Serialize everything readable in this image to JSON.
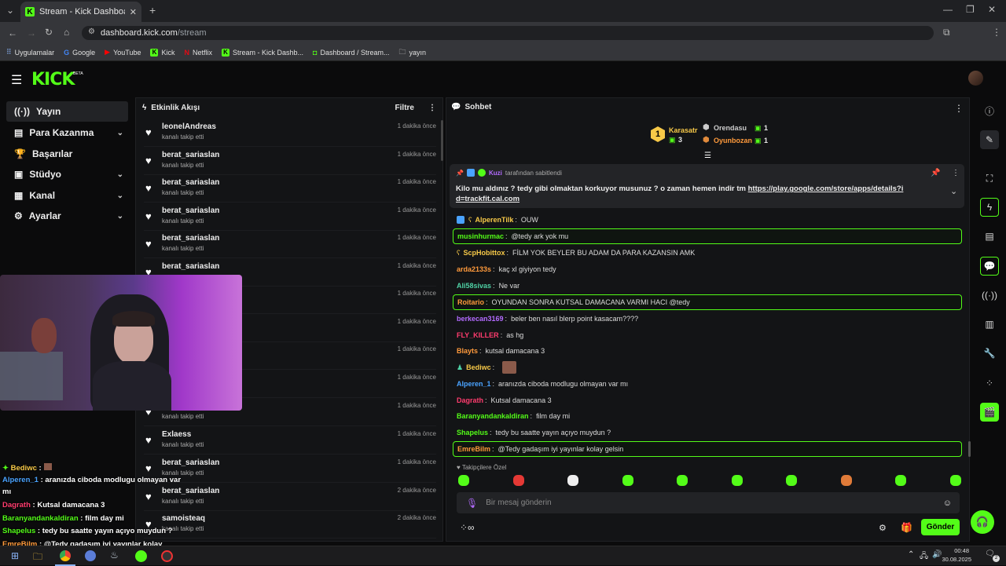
{
  "browser": {
    "tab_title": "Stream - Kick Dashboard",
    "url_domain": "dashboard.kick.com",
    "url_path": "/stream",
    "bookmarks": [
      "Uygulamalar",
      "Google",
      "YouTube",
      "Kick",
      "Netflix",
      "Stream - Kick Dashb...",
      "Dashboard / Stream...",
      "yayın"
    ]
  },
  "kick": {
    "logo": "KICK",
    "beta": "BETA"
  },
  "sidebar": {
    "items": [
      {
        "label": "Yayın",
        "icon": "broadcast-icon",
        "active": true
      },
      {
        "label": "Para Kazanma",
        "icon": "money-icon",
        "chevron": true
      },
      {
        "label": "Başarılar",
        "icon": "trophy-icon"
      },
      {
        "label": "Stüdyo",
        "icon": "studio-icon",
        "chevron": true
      },
      {
        "label": "Kanal",
        "icon": "channel-icon",
        "chevron": true
      },
      {
        "label": "Ayarlar",
        "icon": "gear-icon",
        "chevron": true
      }
    ]
  },
  "activity": {
    "title": "Etkinlik Akışı",
    "filter": "Filtre",
    "items": [
      {
        "name": "leonelAndreas",
        "action": "kanalı takip etti",
        "time": "1 dakika önce"
      },
      {
        "name": "berat_sariaslan",
        "action": "kanalı takip etti",
        "time": "1 dakika önce"
      },
      {
        "name": "berat_sariaslan",
        "action": "kanalı takip etti",
        "time": "1 dakika önce"
      },
      {
        "name": "berat_sariaslan",
        "action": "kanalı takip etti",
        "time": "1 dakika önce"
      },
      {
        "name": "berat_sariaslan",
        "action": "kanalı takip etti",
        "time": "1 dakika önce"
      },
      {
        "name": "berat_sariaslan",
        "action": "",
        "time": "1 dakika önce"
      },
      {
        "name": "",
        "action": "",
        "time": "1 dakika önce"
      },
      {
        "name": "",
        "action": "",
        "time": "1 dakika önce"
      },
      {
        "name": "",
        "action": "",
        "time": "1 dakika önce"
      },
      {
        "name": "",
        "action": "",
        "time": "1 dakika önce"
      },
      {
        "name": "berat_sariaslan",
        "action": "kanalı takip etti",
        "time": "1 dakika önce"
      },
      {
        "name": "Exlaess",
        "action": "kanalı takip etti",
        "time": "1 dakika önce"
      },
      {
        "name": "berat_sariaslan",
        "action": "kanalı takip etti",
        "time": "1 dakika önce"
      },
      {
        "name": "berat_sariaslan",
        "action": "kanalı takip etti",
        "time": "2 dakika önce"
      },
      {
        "name": "samoisteaq",
        "action": "kanalı takip etti",
        "time": "2 dakika önce"
      }
    ]
  },
  "chat": {
    "title": "Sohbet",
    "leaders": {
      "first_name": "Karasatr",
      "first_count": "3",
      "first_rank": "1",
      "second_name": "Orendasu",
      "second_count": "1",
      "third_name": "Oyunbozan",
      "third_count": "1"
    },
    "pinned": {
      "by": "Kuzi",
      "by_suffix": "tarafından sabitlendi",
      "text": "Kilo mu aldınız ? tedy gibi olmaktan korkuyor musunuz ? o zaman hemen indir tm",
      "link": "https://play.google.com/store/apps/details?id=trackfit.cal.com"
    },
    "messages": [
      {
        "user": "AlperenTilk",
        "text": "OUW",
        "color": "#f7c948",
        "hl": false
      },
      {
        "user": "musinhurmac",
        "text": "@tedy ark yok mu",
        "color": "#53fc18",
        "hl": true
      },
      {
        "user": "ScpHobittox",
        "text": "FİLM YOK BEYLER BU ADAM DA PARA KAZANSIN AMK",
        "color": "#f7c948",
        "hl": false
      },
      {
        "user": "arda2133s",
        "text": "kaç xl giyiyon tedy",
        "color": "#ff9a3c",
        "hl": false
      },
      {
        "user": "Ali58sivas",
        "text": "Ne var",
        "color": "#4fd1a5",
        "hl": false
      },
      {
        "user": "Roitario",
        "text": "OYUNDAN SONRA KUTSAL DAMACANA VARMI HACI @tedy",
        "color": "#ff9a3c",
        "hl": true
      },
      {
        "user": "berkecan3169",
        "text": "beler ben nasıl blerp point kasacam????",
        "color": "#b36bff",
        "hl": false
      },
      {
        "user": "FLY_KILLER",
        "text": "as hg",
        "color": "#ff3c6e",
        "hl": false
      },
      {
        "user": "Blayts",
        "text": "kutsal damacana 3",
        "color": "#ff9a3c",
        "hl": false
      },
      {
        "user": "Bediwc",
        "text": "",
        "color": "#f7c948",
        "hl": false
      },
      {
        "user": "Alperen_1",
        "text": "aranızda ciboda modlugu olmayan var mı",
        "color": "#4aa3ff",
        "hl": false
      },
      {
        "user": "Dagrath",
        "text": "Kutsal damacana 3",
        "color": "#ff3c6e",
        "hl": false
      },
      {
        "user": "Baranyandankaldiran",
        "text": "film day mi",
        "color": "#53fc18",
        "hl": false
      },
      {
        "user": "Shapelus",
        "text": "tedy bu saatte yayın açıyo muydun ?",
        "color": "#53fc18",
        "hl": false
      },
      {
        "user": "EmreBilm",
        "text": "@Tedy gadaşım iyi yayınlar kolay gelsin",
        "color": "#ff9a3c",
        "hl": true
      }
    ],
    "followers_only": "Takipçilere Özel",
    "input_placeholder": "Bir mesaj gönderin",
    "send": "Gönder"
  },
  "overlay": {
    "lines": [
      {
        "user": "Bediwc",
        "sep": " :",
        "text": "",
        "color": "#f7c948"
      },
      {
        "user": "Alperen_1",
        "sep": " : ",
        "text": "aranızda ciboda modlugu olmayan var",
        "color": "#4aa3ff"
      },
      {
        "user": "",
        "sep": "",
        "text": "mı",
        "color": "#ffffff"
      },
      {
        "user": "Dagrath",
        "sep": " : ",
        "text": "Kutsal damacana 3",
        "color": "#ff3c6e"
      },
      {
        "user": "Baranyandankaldiran",
        "sep": " : ",
        "text": "film day mi",
        "color": "#53fc18"
      },
      {
        "user": "Shapelus",
        "sep": " : ",
        "text": "tedy bu saatte yayın açıyo muydun ?",
        "color": "#53fc18"
      },
      {
        "user": "EmreBilm",
        "sep": " : ",
        "text": "@Tedy gadaşım iyi yayınlar kolay",
        "color": "#ff9a3c"
      },
      {
        "user": "",
        "sep": "",
        "text": "gelsin",
        "color": "#ffffff"
      }
    ]
  },
  "taskbar": {
    "time": "00:48",
    "date": "30.08.2025",
    "notif": "2"
  }
}
